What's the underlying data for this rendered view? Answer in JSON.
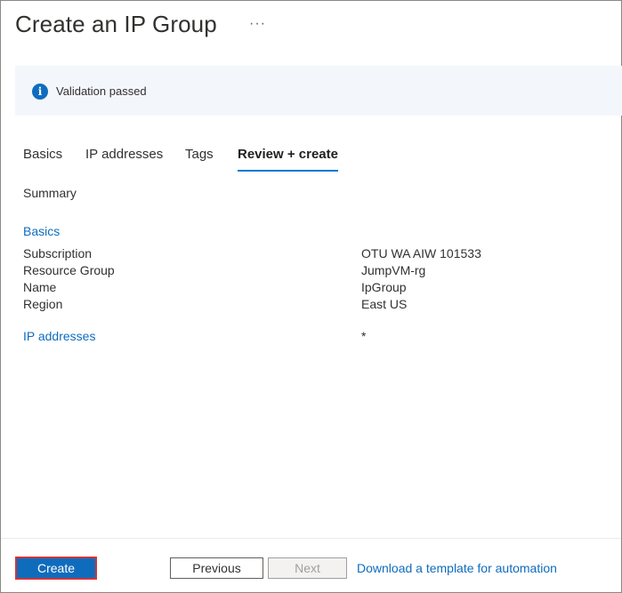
{
  "header": {
    "title": "Create an IP Group",
    "more_icon": "ellipsis-icon",
    "more_label": "···"
  },
  "banner": {
    "icon": "info-icon",
    "icon_glyph": "i",
    "text": "Validation passed",
    "icon_color": "#0f6cbd",
    "background": "#f3f6fb"
  },
  "tabs": [
    {
      "label": "Basics",
      "active": false
    },
    {
      "label": "IP addresses",
      "active": false
    },
    {
      "label": "Tags",
      "active": false
    },
    {
      "label": "Review + create",
      "active": true
    }
  ],
  "summary": {
    "heading": "Summary",
    "basics_section": {
      "title": "Basics",
      "rows": [
        {
          "label": "Subscription",
          "value": "OTU WA AIW 101533"
        },
        {
          "label": "Resource Group",
          "value": "JumpVM-rg"
        },
        {
          "label": "Name",
          "value": "IpGroup"
        },
        {
          "label": "Region",
          "value": "East US"
        }
      ]
    },
    "ip_section": {
      "title": "IP addresses",
      "value": "*"
    }
  },
  "footer": {
    "create_label": "Create",
    "previous_label": "Previous",
    "next_label": "Next",
    "download_link": "Download a template for automation"
  },
  "colors": {
    "accent": "#0078d4",
    "link": "#0f6cbd",
    "highlight_border": "#d13438"
  }
}
